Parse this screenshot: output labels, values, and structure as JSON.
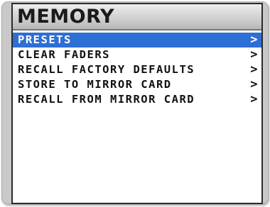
{
  "screen": {
    "title": "MEMORY"
  },
  "menu": {
    "selected_index": 0,
    "highlight_color": "#2e6fd6",
    "items": [
      {
        "label": "PRESETS",
        "arrow": ">"
      },
      {
        "label": "CLEAR FADERS",
        "arrow": ">"
      },
      {
        "label": "RECALL FACTORY DEFAULTS",
        "arrow": ">"
      },
      {
        "label": "STORE TO MIRROR CARD",
        "arrow": ">"
      },
      {
        "label": "RECALL FROM MIRROR CARD",
        "arrow": ">"
      }
    ]
  }
}
